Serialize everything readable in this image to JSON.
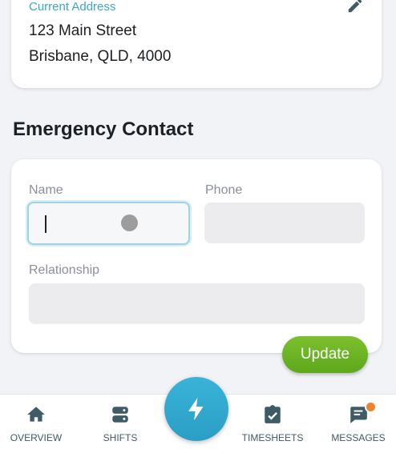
{
  "address": {
    "label": "Current Address",
    "line1": "123 Main Street",
    "line2": "Brisbane, QLD, 4000"
  },
  "emergency_contact": {
    "title": "Emergency Contact",
    "name_label": "Name",
    "name_value": "",
    "phone_label": "Phone",
    "phone_value": "",
    "relationship_label": "Relationship",
    "relationship_value": ""
  },
  "update_button": "Update",
  "nav": {
    "items": [
      {
        "label": "OVERVIEW",
        "icon": "home-icon"
      },
      {
        "label": "SHIFTS",
        "icon": "server-icon"
      },
      {
        "label": "",
        "icon": "lightning-icon"
      },
      {
        "label": "TIMESHEETS",
        "icon": "clipboard-check-icon"
      },
      {
        "label": "MESSAGES",
        "icon": "message-icon"
      }
    ]
  },
  "colors": {
    "accent": "#3aa7c9",
    "primary_button": "#6cb625",
    "nav_text": "#3f5b66",
    "notification": "#f0822d"
  }
}
